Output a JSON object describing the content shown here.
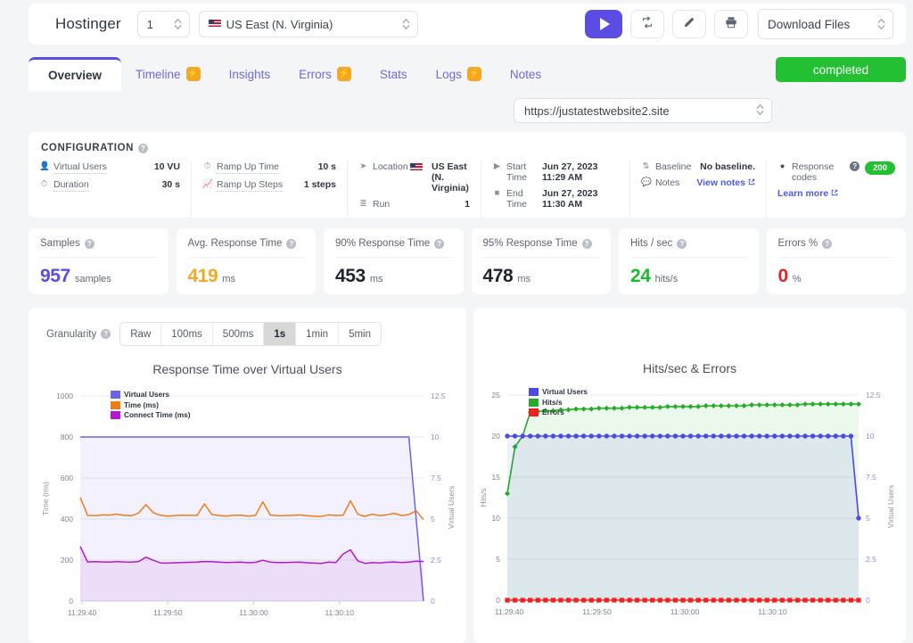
{
  "topbar": {
    "brand": "Hostinger",
    "count_value": "1",
    "location_value": "US East (N. Virginia)",
    "download_label": "Download Files",
    "icons": {
      "play": "play-icon",
      "repeat": "repeat-icon",
      "edit": "pencil-icon",
      "print": "printer-icon"
    }
  },
  "tabs": [
    {
      "label": "Overview",
      "badge": false,
      "active": true
    },
    {
      "label": "Timeline",
      "badge": true,
      "active": false
    },
    {
      "label": "Insights",
      "badge": false,
      "active": false
    },
    {
      "label": "Errors",
      "badge": true,
      "active": false
    },
    {
      "label": "Stats",
      "badge": false,
      "active": false
    },
    {
      "label": "Logs",
      "badge": true,
      "active": false
    },
    {
      "label": "Notes",
      "badge": false,
      "active": false
    }
  ],
  "status": {
    "label": "completed",
    "color": "#22c032"
  },
  "url_select": {
    "value": "https://justatestwebsite2.site"
  },
  "configuration": {
    "title": "CONFIGURATION",
    "columns": [
      {
        "rows": [
          {
            "icon": "user-icon",
            "label": "Virtual Users",
            "value": "10 VU"
          },
          {
            "icon": "clock-icon",
            "label": "Duration",
            "value": "30 s"
          }
        ]
      },
      {
        "rows": [
          {
            "icon": "clock-icon",
            "label": "Ramp Up Time",
            "value": "10 s"
          },
          {
            "icon": "chart-line-icon",
            "label": "Ramp Up Steps",
            "value": "1 steps"
          }
        ]
      },
      {
        "rows": [
          {
            "icon": "location-arrow-icon",
            "label": "Location",
            "value": "US East (N. Virginia)",
            "flag": true
          },
          {
            "icon": "list-icon",
            "label": "Run",
            "value": "1"
          }
        ]
      },
      {
        "rows": [
          {
            "icon": "play-icon",
            "label": "Start Time",
            "value": "Jun 27, 2023 11:29 AM"
          },
          {
            "icon": "stop-icon",
            "label": "End Time",
            "value": "Jun 27, 2023 11:30 AM"
          }
        ]
      },
      {
        "rows": [
          {
            "icon": "baseline-icon",
            "label": "Baseline",
            "value": "No baseline."
          },
          {
            "icon": "comment-icon",
            "label": "Notes",
            "link": "View notes"
          }
        ]
      },
      {
        "rows": [
          {
            "icon": "circle-icon",
            "label": "Response codes",
            "badge": "200"
          },
          {
            "link": "Learn more"
          }
        ]
      }
    ]
  },
  "stats": [
    {
      "title": "Samples",
      "value": "957",
      "unit": "samples",
      "color": "#5b4ce4"
    },
    {
      "title": "Avg. Response Time",
      "value": "419",
      "unit": "ms",
      "color": "#f5a623"
    },
    {
      "title": "90% Response Time",
      "value": "453",
      "unit": "ms",
      "color": "#1f2530"
    },
    {
      "title": "95% Response Time",
      "value": "478",
      "unit": "ms",
      "color": "#1f2530"
    },
    {
      "title": "Hits / sec",
      "value": "24",
      "unit": "hits/s",
      "color": "#19bb2e"
    },
    {
      "title": "Errors %",
      "value": "0",
      "unit": "%",
      "color": "#e02424"
    }
  ],
  "granularity": {
    "label": "Granularity",
    "options": [
      "Raw",
      "100ms",
      "500ms",
      "1s",
      "1min",
      "5min"
    ],
    "selected": "1s"
  },
  "chart_data": [
    {
      "type": "line",
      "title": "Response Time over Virtual Users",
      "xlabel": "",
      "ylabel": "Time (ms)",
      "y2label": "Virtual Users",
      "ylim": [
        0,
        1000
      ],
      "y2lim": [
        0,
        12.5
      ],
      "yticks": [
        "0",
        "200",
        "400",
        "600",
        "800",
        "1000"
      ],
      "y2ticks": [
        "0",
        "2.5",
        "5",
        "7.5",
        "10",
        "12.5"
      ],
      "xticks": [
        "11:29:40",
        "11:29:50",
        "11:30:00",
        "11:30:10"
      ],
      "grid": true,
      "legend_position": "top-left",
      "series": [
        {
          "name": "Virtual Users",
          "color": "#6b63e8",
          "axis": "right",
          "values": [
            10,
            10,
            10,
            10,
            10,
            10,
            10,
            10,
            10,
            10,
            10,
            10,
            10,
            10,
            10,
            10,
            10,
            10,
            10,
            10,
            10,
            10,
            10,
            10,
            10,
            10,
            10,
            10,
            10,
            10,
            10,
            10,
            10,
            10,
            10,
            10,
            10,
            10,
            10,
            10,
            10,
            10,
            10,
            10,
            10,
            10,
            5,
            0
          ]
        },
        {
          "name": "Time (ms)",
          "color": "#ef7d17",
          "axis": "left",
          "values": [
            505,
            418,
            416,
            420,
            419,
            424,
            418,
            416,
            429,
            470,
            431,
            418,
            414,
            417,
            419,
            418,
            418,
            474,
            423,
            417,
            415,
            418,
            419,
            414,
            418,
            484,
            420,
            416,
            417,
            418,
            420,
            416,
            414,
            412,
            421,
            417,
            419,
            489,
            423,
            413,
            424,
            416,
            421,
            428,
            417,
            422,
            440,
            398
          ]
        },
        {
          "name": "Connect Time (ms)",
          "color": "#b516cf",
          "axis": "left",
          "values": [
            266,
            191,
            192,
            191,
            190,
            193,
            191,
            190,
            193,
            214,
            199,
            186,
            185,
            187,
            188,
            189,
            190,
            193,
            192,
            190,
            188,
            189,
            190,
            187,
            189,
            199,
            190,
            188,
            188,
            189,
            190,
            187,
            185,
            184,
            190,
            188,
            230,
            250,
            196,
            184,
            188,
            186,
            189,
            191,
            188,
            190,
            195,
            193
          ]
        }
      ]
    },
    {
      "type": "line",
      "title": "Hits/sec & Errors",
      "xlabel": "",
      "ylabel": "Hits/s",
      "y2label": "Virtual Users",
      "ylim": [
        0,
        25
      ],
      "y2lim": [
        0,
        12.5
      ],
      "yticks": [
        "0",
        "5",
        "10",
        "15",
        "20",
        "25"
      ],
      "y2ticks": [
        "0",
        "2.5",
        "5",
        "7.5",
        "10",
        "12.5"
      ],
      "xticks": [
        "11:29:40",
        "11:29:50",
        "11:30:00",
        "11:30:10"
      ],
      "grid": true,
      "legend_position": "top-left",
      "series": [
        {
          "name": "Virtual Users",
          "color": "#4d49e6",
          "axis": "right",
          "marker": "circle",
          "values": [
            10,
            10,
            10,
            10,
            10,
            10,
            10,
            10,
            10,
            10,
            10,
            10,
            10,
            10,
            10,
            10,
            10,
            10,
            10,
            10,
            10,
            10,
            10,
            10,
            10,
            10,
            10,
            10,
            10,
            10,
            10,
            10,
            10,
            10,
            10,
            10,
            10,
            10,
            10,
            10,
            10,
            10,
            10,
            10,
            10,
            10,
            5
          ]
        },
        {
          "name": "Hits/s",
          "color": "#22ad27",
          "axis": "left",
          "marker": "diamond",
          "values": [
            13,
            18.7,
            20,
            22.9,
            23,
            23.1,
            23.1,
            23.2,
            23.2,
            23.3,
            23.3,
            23.3,
            23.4,
            23.4,
            23.4,
            23.4,
            23.5,
            23.5,
            23.5,
            23.5,
            23.5,
            23.6,
            23.6,
            23.6,
            23.6,
            23.6,
            23.7,
            23.7,
            23.7,
            23.7,
            23.7,
            23.7,
            23.8,
            23.8,
            23.8,
            23.8,
            23.8,
            23.8,
            23.8,
            23.9,
            23.9,
            23.9,
            23.9,
            23.9,
            23.9,
            23.9,
            23.9
          ]
        },
        {
          "name": "Errors",
          "color": "#ee2020",
          "axis": "left",
          "marker": "square",
          "values": [
            0,
            0,
            0,
            0,
            0,
            0,
            0,
            0,
            0,
            0,
            0,
            0,
            0,
            0,
            0,
            0,
            0,
            0,
            0,
            0,
            0,
            0,
            0,
            0,
            0,
            0,
            0,
            0,
            0,
            0,
            0,
            0,
            0,
            0,
            0,
            0,
            0,
            0,
            0,
            0,
            0,
            0,
            0,
            0,
            0,
            0,
            0
          ]
        }
      ]
    }
  ]
}
